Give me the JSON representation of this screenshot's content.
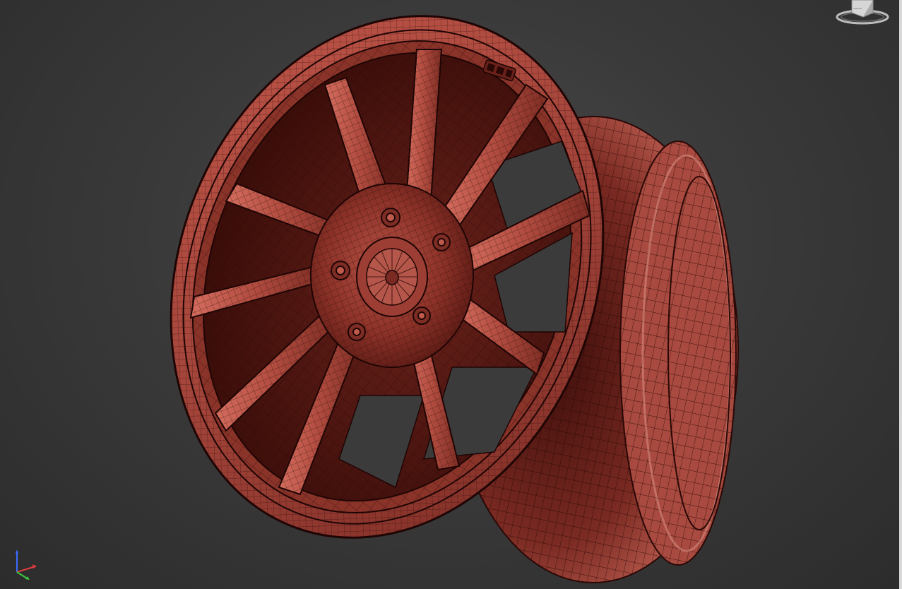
{
  "viewport": {
    "label": "",
    "mode": "perspective-shaded-wireframe",
    "colors": {
      "background_center": "#4a4a4a",
      "background_edge": "#2c2c2c",
      "model_base": "#a8463b",
      "model_highlight": "#d06a5b",
      "model_shadow": "#4a1410",
      "wire": "#2a0806"
    }
  },
  "model": {
    "name": "wheel-rim",
    "spoke_count": 10,
    "lug_count": 5
  },
  "viewcube": {
    "icon": "viewcube-icon"
  },
  "axis_gizmo": {
    "icon": "axis-tripod-icon",
    "colors": {
      "x": "#e03c3c",
      "y": "#3cc83c",
      "z": "#3c6cff"
    }
  }
}
